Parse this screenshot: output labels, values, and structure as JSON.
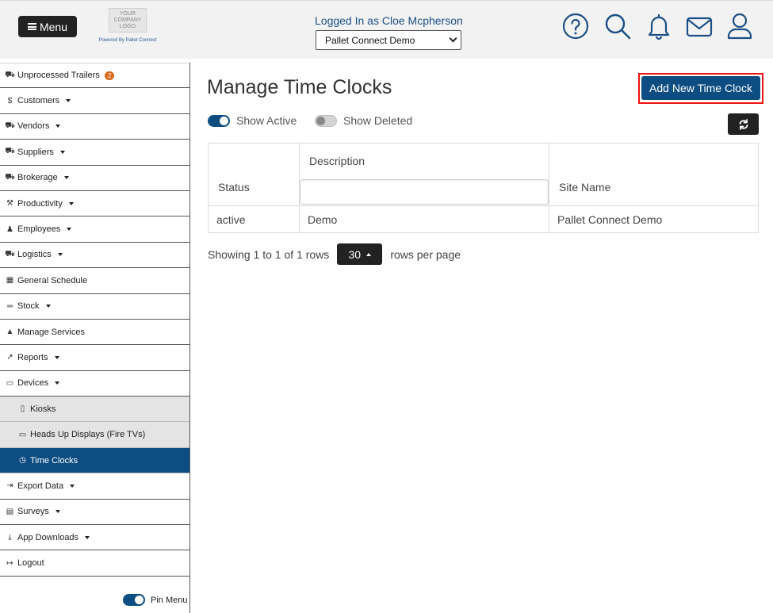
{
  "header": {
    "menu_label": "Menu",
    "logo_text": "YOUR COMPANY LOGO",
    "powered_by": "Powered By Pallet Connect",
    "logged_in": "Logged In as Cloe Mcpherson",
    "site_selected": "Pallet Connect Demo",
    "icons": [
      "help-circle-icon",
      "search-icon",
      "bell-icon",
      "envelope-icon",
      "user-icon"
    ],
    "icon_color": "#1c4f86"
  },
  "sidebar": {
    "items": [
      {
        "label": "Unprocessed Trailers",
        "icon": "trailer-icon",
        "badge": "2",
        "caret": false
      },
      {
        "label": "Customers",
        "icon": "dollar-icon",
        "caret": true
      },
      {
        "label": "Vendors",
        "icon": "truck-icon",
        "caret": true
      },
      {
        "label": "Suppliers",
        "icon": "truck-loaded-icon",
        "caret": true
      },
      {
        "label": "Brokerage",
        "icon": "truck-fast-icon",
        "caret": true
      },
      {
        "label": "Productivity",
        "icon": "hammer-icon",
        "caret": true
      },
      {
        "label": "Employees",
        "icon": "person-icon",
        "caret": true
      },
      {
        "label": "Logistics",
        "icon": "truck-icon",
        "caret": true
      },
      {
        "label": "General Schedule",
        "icon": "calendar-icon",
        "caret": false
      },
      {
        "label": "Stock",
        "icon": "pallet-icon",
        "caret": true
      },
      {
        "label": "Manage Services",
        "icon": "bell-service-icon",
        "caret": false
      },
      {
        "label": "Reports",
        "icon": "chart-line-icon",
        "caret": true
      },
      {
        "label": "Devices",
        "icon": "monitor-icon",
        "caret": true
      },
      {
        "label": "Kiosks",
        "icon": "tablet-icon",
        "sub": true
      },
      {
        "label": "Heads Up Displays (Fire TVs)",
        "icon": "monitor-icon",
        "sub": true
      },
      {
        "label": "Time Clocks",
        "icon": "clock-icon",
        "sub": true,
        "active": true
      },
      {
        "label": "Export Data",
        "icon": "file-export-icon",
        "caret": true
      },
      {
        "label": "Surveys",
        "icon": "clipboard-icon",
        "caret": true
      },
      {
        "label": "App Downloads",
        "icon": "download-icon",
        "caret": true
      },
      {
        "label": "Logout",
        "icon": "sign-out-icon",
        "caret": false
      }
    ],
    "pin_label": "Pin Menu"
  },
  "main": {
    "title": "Manage Time Clocks",
    "add_button": "Add New Time Clock",
    "show_active": "Show Active",
    "show_deleted": "Show Deleted",
    "table": {
      "columns": [
        "Status",
        "Description",
        "Site Name"
      ],
      "rows": [
        [
          "active",
          "Demo",
          "Pallet Connect Demo"
        ]
      ]
    },
    "pager": {
      "showing": "Showing 1 to 1 of 1 rows",
      "rows_per_page_value": "30",
      "rows_per_page_label": "rows per page"
    }
  }
}
